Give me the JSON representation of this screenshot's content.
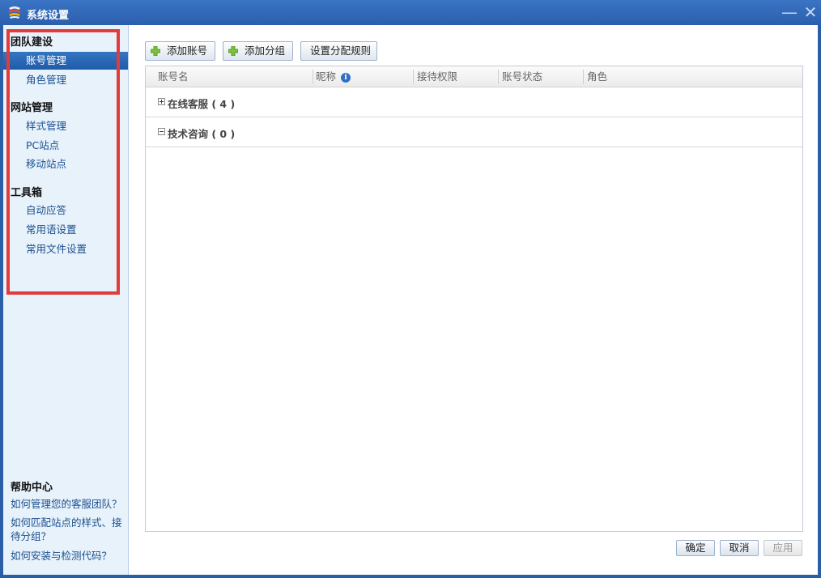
{
  "window": {
    "title": "系统设置",
    "minimize_glyph": "—",
    "close_glyph": "✕"
  },
  "sidebar": {
    "sections": [
      {
        "heading": "团队建设",
        "items": [
          {
            "label": "账号管理",
            "active": true
          },
          {
            "label": "角色管理",
            "active": false
          }
        ]
      },
      {
        "heading": "网站管理",
        "items": [
          {
            "label": "样式管理",
            "active": false
          },
          {
            "label": "PC站点",
            "active": false
          },
          {
            "label": "移动站点",
            "active": false
          }
        ]
      },
      {
        "heading": "工具箱",
        "items": [
          {
            "label": "自动应答",
            "active": false
          },
          {
            "label": "常用语设置",
            "active": false
          },
          {
            "label": "常用文件设置",
            "active": false
          }
        ]
      }
    ],
    "help": {
      "title": "帮助中心",
      "links": [
        "如何管理您的客服团队？",
        "如何匹配站点的样式、接待分组？",
        "如何安装与检测代码？"
      ]
    }
  },
  "toolbar": {
    "add_account": "添加账号",
    "add_group": "添加分组",
    "set_rules": "设置分配规则"
  },
  "grid": {
    "columns": [
      "账号名",
      "昵称",
      "接待权限",
      "账号状态",
      "角色"
    ],
    "info_glyph": "i",
    "groups": [
      {
        "label": "在线客服 ( 4 )",
        "expanded": false
      },
      {
        "label": "技术咨询 ( 0 )",
        "expanded": true
      }
    ]
  },
  "footer": {
    "ok": "确定",
    "cancel": "取消",
    "apply": "应用"
  },
  "colors": {
    "titlebar": "#2b5fae",
    "sidebar_bg": "#e7f2fb",
    "active_item": "#1f5ba8",
    "link": "#1c4f8f",
    "highlight_frame": "#e23b3b"
  }
}
